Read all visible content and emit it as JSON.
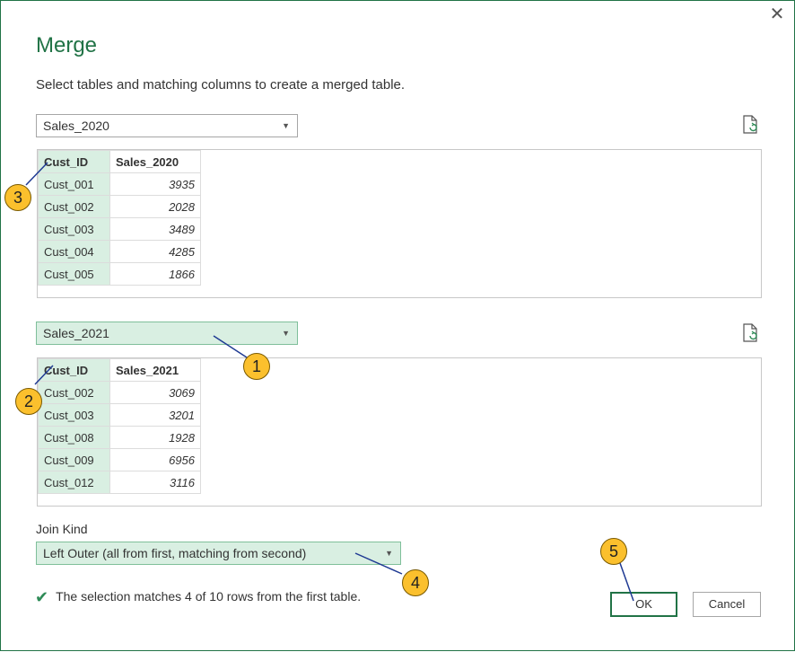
{
  "dialog": {
    "title": "Merge",
    "subtitle": "Select tables and matching columns to create a merged table.",
    "close_glyph": "✕"
  },
  "first": {
    "selected": "Sales_2020",
    "headers": [
      "Cust_ID",
      "Sales_2020"
    ],
    "rows": [
      [
        "Cust_001",
        "3935"
      ],
      [
        "Cust_002",
        "2028"
      ],
      [
        "Cust_003",
        "3489"
      ],
      [
        "Cust_004",
        "4285"
      ],
      [
        "Cust_005",
        "1866"
      ]
    ]
  },
  "second": {
    "selected": "Sales_2021",
    "headers": [
      "Cust_ID",
      "Sales_2021"
    ],
    "rows": [
      [
        "Cust_002",
        "3069"
      ],
      [
        "Cust_003",
        "3201"
      ],
      [
        "Cust_008",
        "1928"
      ],
      [
        "Cust_009",
        "6956"
      ],
      [
        "Cust_012",
        "3116"
      ]
    ]
  },
  "join": {
    "label": "Join Kind",
    "selected": "Left Outer (all from first, matching from second)"
  },
  "status": {
    "text": "The selection matches 4 of 10 rows from the first table."
  },
  "buttons": {
    "ok": "OK",
    "cancel": "Cancel"
  },
  "callouts": [
    "1",
    "2",
    "3",
    "4",
    "5"
  ],
  "icons": {
    "refresh": "refresh-file-icon",
    "check": "checkmark-icon",
    "close": "close-icon",
    "dropdown": "chevron-down-icon"
  },
  "colors": {
    "accent": "#217346",
    "selected_bg": "#d9efe2",
    "callout": "#fbc02d"
  }
}
